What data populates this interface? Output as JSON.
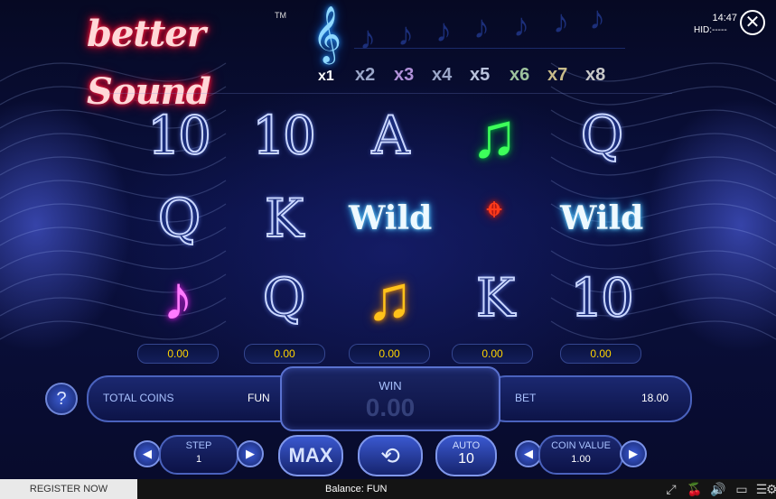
{
  "logo": {
    "text": "better Sound",
    "trademark": "TM"
  },
  "multipliers": [
    "x1",
    "x2",
    "x3",
    "x4",
    "x5",
    "x6",
    "x7",
    "x8"
  ],
  "multiplier_colors": [
    "#ffffff",
    "#9aa6c8",
    "#b090d8",
    "#9aa6c8",
    "#b9c2dc",
    "#9dc29d",
    "#c8bb8a",
    "#c8c8c8"
  ],
  "status": {
    "clock": "14:47",
    "hid": "HID:-----"
  },
  "reels": [
    [
      {
        "kind": "num",
        "label": "10"
      },
      {
        "kind": "letter",
        "label": "Q"
      },
      {
        "kind": "note-pink",
        "label": "♪"
      }
    ],
    [
      {
        "kind": "num",
        "label": "10"
      },
      {
        "kind": "letter",
        "label": "K"
      },
      {
        "kind": "letter",
        "label": "Q"
      }
    ],
    [
      {
        "kind": "letter",
        "label": "A"
      },
      {
        "kind": "wild",
        "label": "Wild"
      },
      {
        "kind": "note-yellow",
        "label": "♫"
      }
    ],
    [
      {
        "kind": "note-green",
        "label": "♫"
      },
      {
        "kind": "note-red",
        "label": "𝄌"
      },
      {
        "kind": "letter",
        "label": "K"
      }
    ],
    [
      {
        "kind": "letter",
        "label": "Q"
      },
      {
        "kind": "wild",
        "label": "Wild"
      },
      {
        "kind": "num",
        "label": "10"
      }
    ]
  ],
  "column_wins": [
    "0.00",
    "0.00",
    "0.00",
    "0.00",
    "0.00"
  ],
  "info": {
    "help_label": "?",
    "total_coins_label": "TOTAL COINS",
    "total_coins_value": "FUN",
    "win_label": "WIN",
    "win_value": "0.00",
    "bet_label": "BET",
    "bet_value": "18.00"
  },
  "controls": {
    "step_label": "STEP",
    "step_value": "1",
    "max_label": "MAX",
    "auto_label": "AUTO",
    "auto_value": "10",
    "coin_value_label": "COIN VALUE",
    "coin_value": "1.00"
  },
  "bottom": {
    "register_label": "REGISTER NOW",
    "balance_text": "Balance: FUN"
  },
  "icons": [
    "close-icon",
    "spin-icon",
    "arrow-left-icon",
    "arrow-right-icon",
    "fullscreen-icon",
    "cherries-icon",
    "sound-icon",
    "paytable-icon",
    "menu-icon",
    "settings-icon"
  ]
}
